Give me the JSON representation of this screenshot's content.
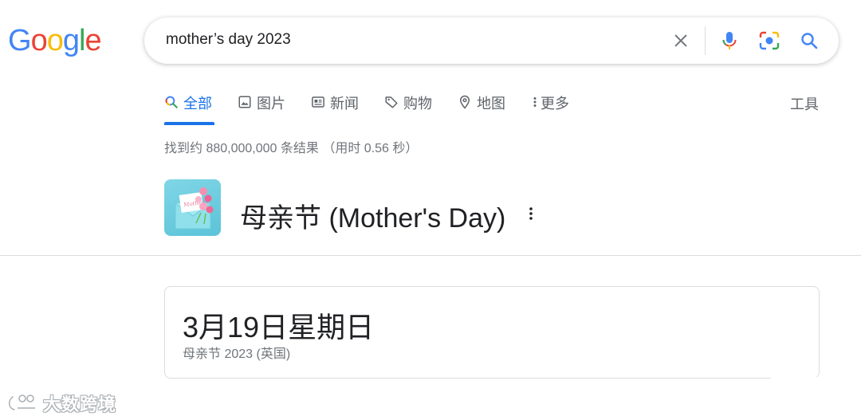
{
  "logo": {
    "text": "Google"
  },
  "search": {
    "query": "mother’s day 2023"
  },
  "tabs": [
    {
      "label": "全部",
      "icon": "search-icon"
    },
    {
      "label": "图片",
      "icon": "image-icon"
    },
    {
      "label": "新闻",
      "icon": "news-icon"
    },
    {
      "label": "购物",
      "icon": "tag-icon"
    },
    {
      "label": "地图",
      "icon": "map-pin-icon"
    },
    {
      "label": "更多",
      "icon": "more-vert-icon"
    }
  ],
  "tools_label": "工具",
  "result_stats": "找到约 880,000,000 条结果  （用时 0.56 秒）",
  "knowledge_panel": {
    "title": "母亲节 (Mother's Day)",
    "thumbnail_text": "Mother's"
  },
  "answer_card": {
    "date": "3月19日星期日",
    "subtitle": "母亲节 2023 (英国)"
  },
  "watermark": {
    "text": "大数跨境"
  },
  "colors": {
    "accent": "#1a73e8",
    "google_blue": "#4285F4",
    "google_red": "#EA4335",
    "google_yellow": "#FBBC05",
    "google_green": "#34A853"
  }
}
